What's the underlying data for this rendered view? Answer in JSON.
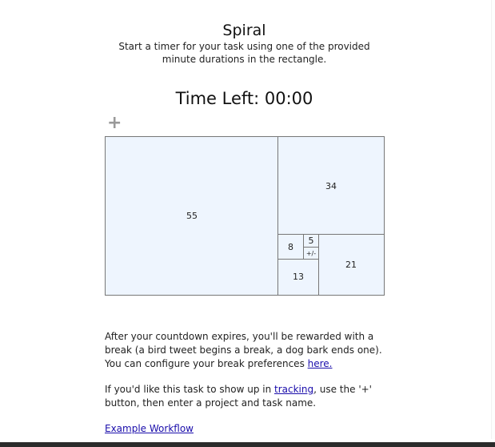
{
  "header": {
    "title": "Spiral",
    "subtitle": "Start a timer for your task using one of the provided minute durations in the rectangle."
  },
  "timer": {
    "label": "Time Left: 00:00"
  },
  "add_button": {
    "symbol": "+"
  },
  "spiral": {
    "cells": {
      "c55": "55",
      "c34": "34",
      "c21": "21",
      "c13": "13",
      "c8": "8",
      "c5": "5",
      "plus_minus": "+/-"
    },
    "fill_color": "#eef5fe",
    "border_color": "#777777"
  },
  "info": {
    "p1_text": "After your countdown expires, you'll be rewarded with a break (a bird tweet begins a break, a dog bark ends one). You can configure your break preferences ",
    "p1_link": "here.",
    "p2_before": "If you'd like this task to show up in ",
    "p2_link": "tracking",
    "p2_after": ", use the '+' button, then enter a project and task name.",
    "workflow_link": "Example Workflow"
  },
  "colors": {
    "link": "#1a0dab",
    "plus_icon": "#999999"
  }
}
